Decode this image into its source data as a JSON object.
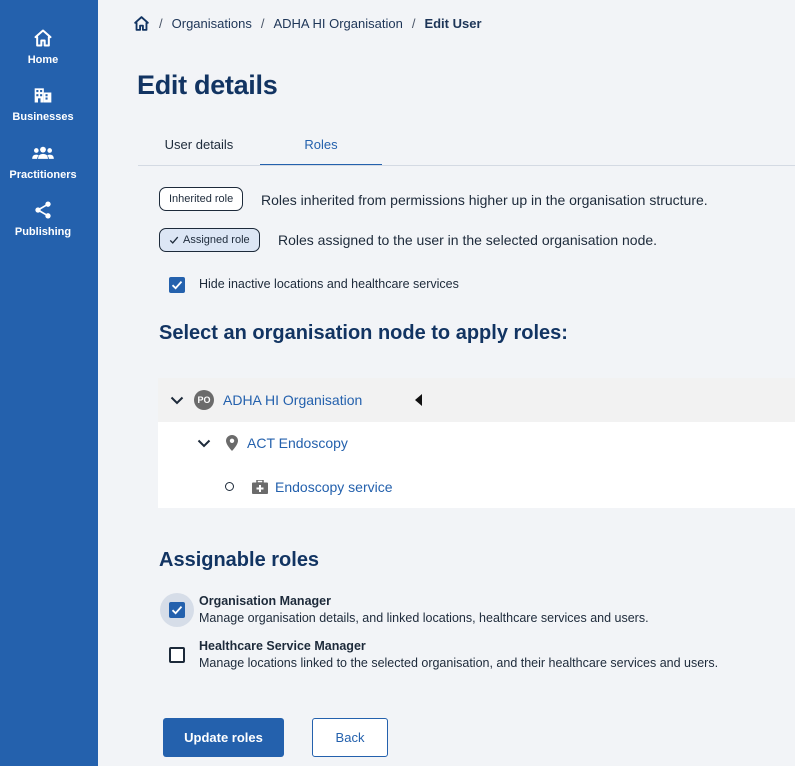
{
  "sidebar": {
    "items": [
      {
        "label": "Home",
        "icon": "home-icon"
      },
      {
        "label": "Businesses",
        "icon": "building-icon"
      },
      {
        "label": "Practitioners",
        "icon": "people-icon"
      },
      {
        "label": "Publishing",
        "icon": "share-icon"
      }
    ]
  },
  "breadcrumb": {
    "home_icon": "home-icon",
    "items": [
      "Organisations",
      "ADHA HI Organisation"
    ],
    "current": "Edit User"
  },
  "page": {
    "title": "Edit details"
  },
  "tabs": [
    {
      "label": "User details",
      "active": false
    },
    {
      "label": "Roles",
      "active": true
    }
  ],
  "legend": {
    "inherited": {
      "badge": "Inherited role",
      "description": "Roles inherited from permissions higher up in the organisation structure."
    },
    "assigned": {
      "badge": "Assigned role",
      "description": "Roles assigned to the user in the selected organisation node."
    }
  },
  "filter": {
    "label": "Hide inactive locations and healthcare services",
    "checked": true
  },
  "tree": {
    "title": "Select an organisation node to apply roles:",
    "nodes": [
      {
        "label": "ADHA HI Organisation",
        "badge": "PO",
        "level": 0,
        "expanded": true,
        "selected": true
      },
      {
        "label": "ACT Endoscopy",
        "icon": "location-pin-icon",
        "level": 1,
        "expanded": true
      },
      {
        "label": "Endoscopy service",
        "icon": "medical-kit-icon",
        "level": 2
      }
    ]
  },
  "roles": {
    "title": "Assignable roles",
    "items": [
      {
        "name": "Organisation Manager",
        "description": "Manage organisation details, and linked locations, healthcare services and users.",
        "checked": true
      },
      {
        "name": "Healthcare Service Manager",
        "description": "Manage locations linked to the selected organisation, and their healthcare services and users.",
        "checked": false
      }
    ]
  },
  "actions": {
    "update_label": "Update roles",
    "back_label": "Back"
  },
  "colors": {
    "primary": "#2461ad",
    "heading": "#123462",
    "background": "#f2f4f7"
  }
}
